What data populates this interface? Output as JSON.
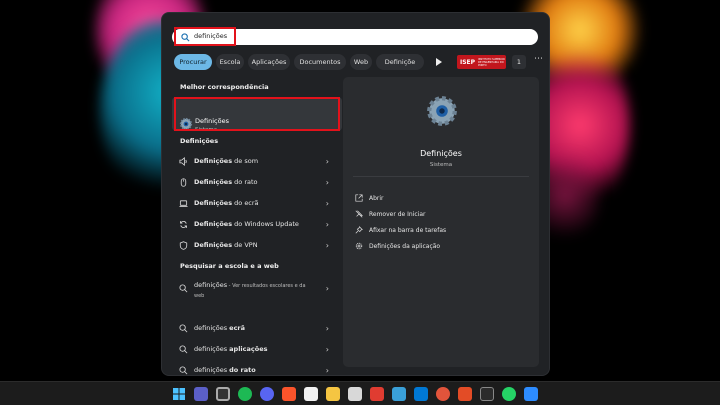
{
  "search": {
    "query": "definições"
  },
  "filters": {
    "chips": [
      "Procurar",
      "Escola",
      "Aplicações",
      "Documentos",
      "Web",
      "Definiçõe"
    ],
    "org_logo_text": "ISEP",
    "org_logo_sub": "INSTITUTO SUPERIOR DE ENGENHARIA DO PORTO",
    "count": "1"
  },
  "best_match": {
    "heading": "Melhor correspondência",
    "title": "Definições",
    "subtitle": "Sistema"
  },
  "settings": {
    "heading": "Definições",
    "items": [
      {
        "bold": "Definições",
        "rest": " de som"
      },
      {
        "bold": "Definições",
        "rest": " do rato"
      },
      {
        "bold": "Definições",
        "rest": " do ecrã"
      },
      {
        "bold": "Definições",
        "rest": " do Windows Update"
      },
      {
        "bold": "Definições",
        "rest": " de VPN"
      }
    ]
  },
  "web": {
    "heading": "Pesquisar a escola e a web",
    "items": [
      {
        "text": "definições",
        "suffix": " - Ver resultados escolares e da web"
      },
      {
        "text": "definições ",
        "bold": "ecrã"
      },
      {
        "text": "definições ",
        "bold": "aplicações"
      },
      {
        "text": "definições ",
        "bold": "do rato"
      }
    ]
  },
  "detail": {
    "title": "Definições",
    "subtitle": "Sistema",
    "actions": [
      "Abrir",
      "Remover de Iniciar",
      "Afixar na barra de tarefas",
      "Definições da aplicação"
    ]
  },
  "colors": {
    "accent": "#6cb8e6",
    "highlight": "#e2121b"
  }
}
